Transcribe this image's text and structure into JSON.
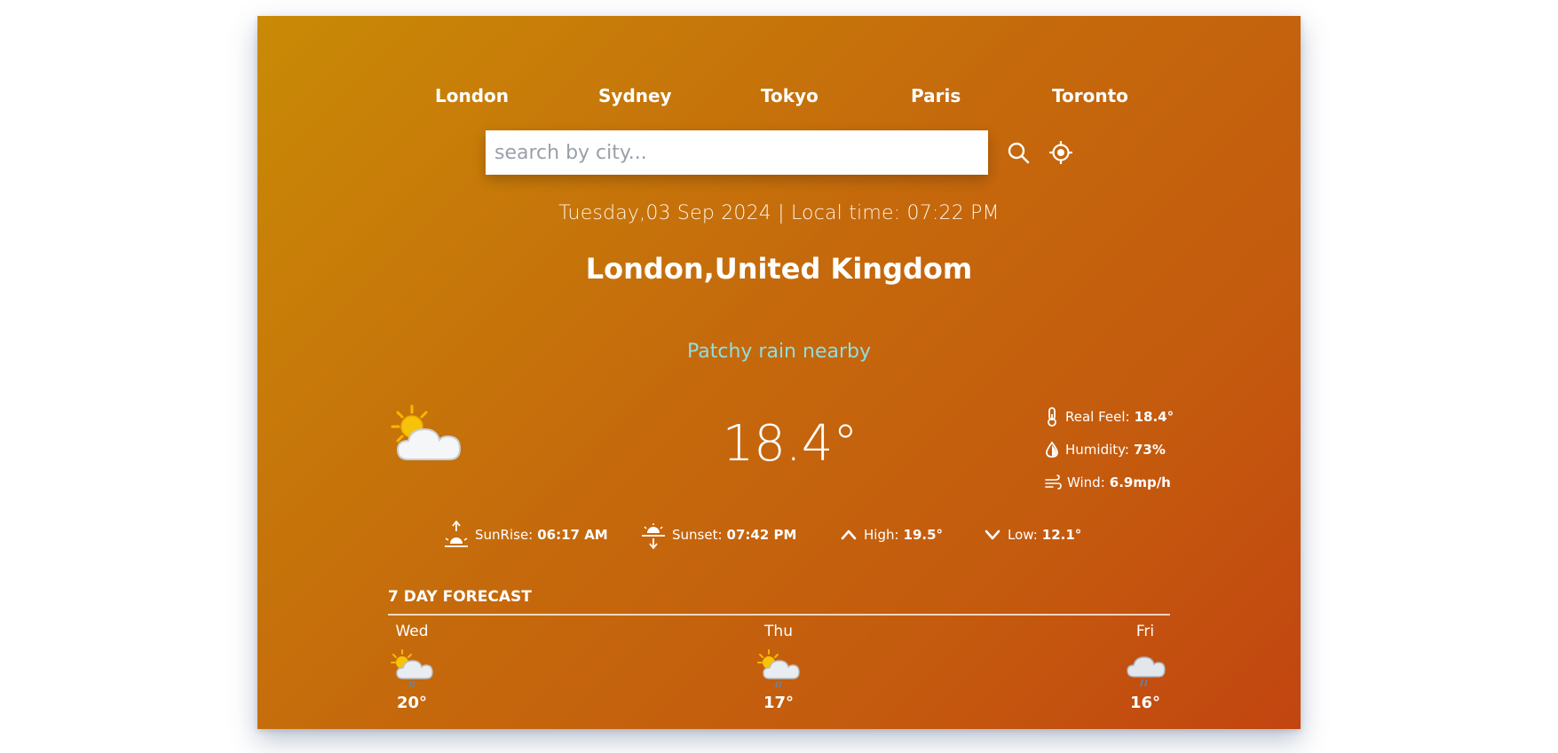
{
  "cities": [
    "London",
    "Sydney",
    "Tokyo",
    "Paris",
    "Toronto"
  ],
  "search": {
    "placeholder": "search by city..."
  },
  "datetime": "Tuesday,03 Sep 2024 | Local time: 07:22 PM",
  "location": "London,United Kingdom",
  "condition": "Patchy rain nearby",
  "temperature": "18.4°",
  "details": {
    "real_feel_label": "Real Feel:",
    "real_feel_value": "18.4°",
    "humidity_label": "Humidity:",
    "humidity_value": "73%",
    "wind_label": "Wind:",
    "wind_value": "6.9mp/h"
  },
  "stats": {
    "sunrise_label": "SunRise:",
    "sunrise_value": "06:17 AM",
    "sunset_label": "Sunset:",
    "sunset_value": "07:42 PM",
    "high_label": "High:",
    "high_value": "19.5°",
    "low_label": "Low:",
    "low_value": "12.1°"
  },
  "forecast": {
    "title": "7 DAY FORECAST",
    "days": [
      {
        "name": "Wed",
        "temp": "20°",
        "icon": "patchy-rain-sun-icon"
      },
      {
        "name": "Thu",
        "temp": "17°",
        "icon": "patchy-rain-sun-icon"
      },
      {
        "name": "Fri",
        "temp": "16°",
        "icon": "rain-cloud-icon"
      }
    ]
  },
  "colors": {
    "condition_text": "#8fdde0",
    "card_gradient_start": "#c98a06",
    "card_gradient_end": "#c24510"
  }
}
